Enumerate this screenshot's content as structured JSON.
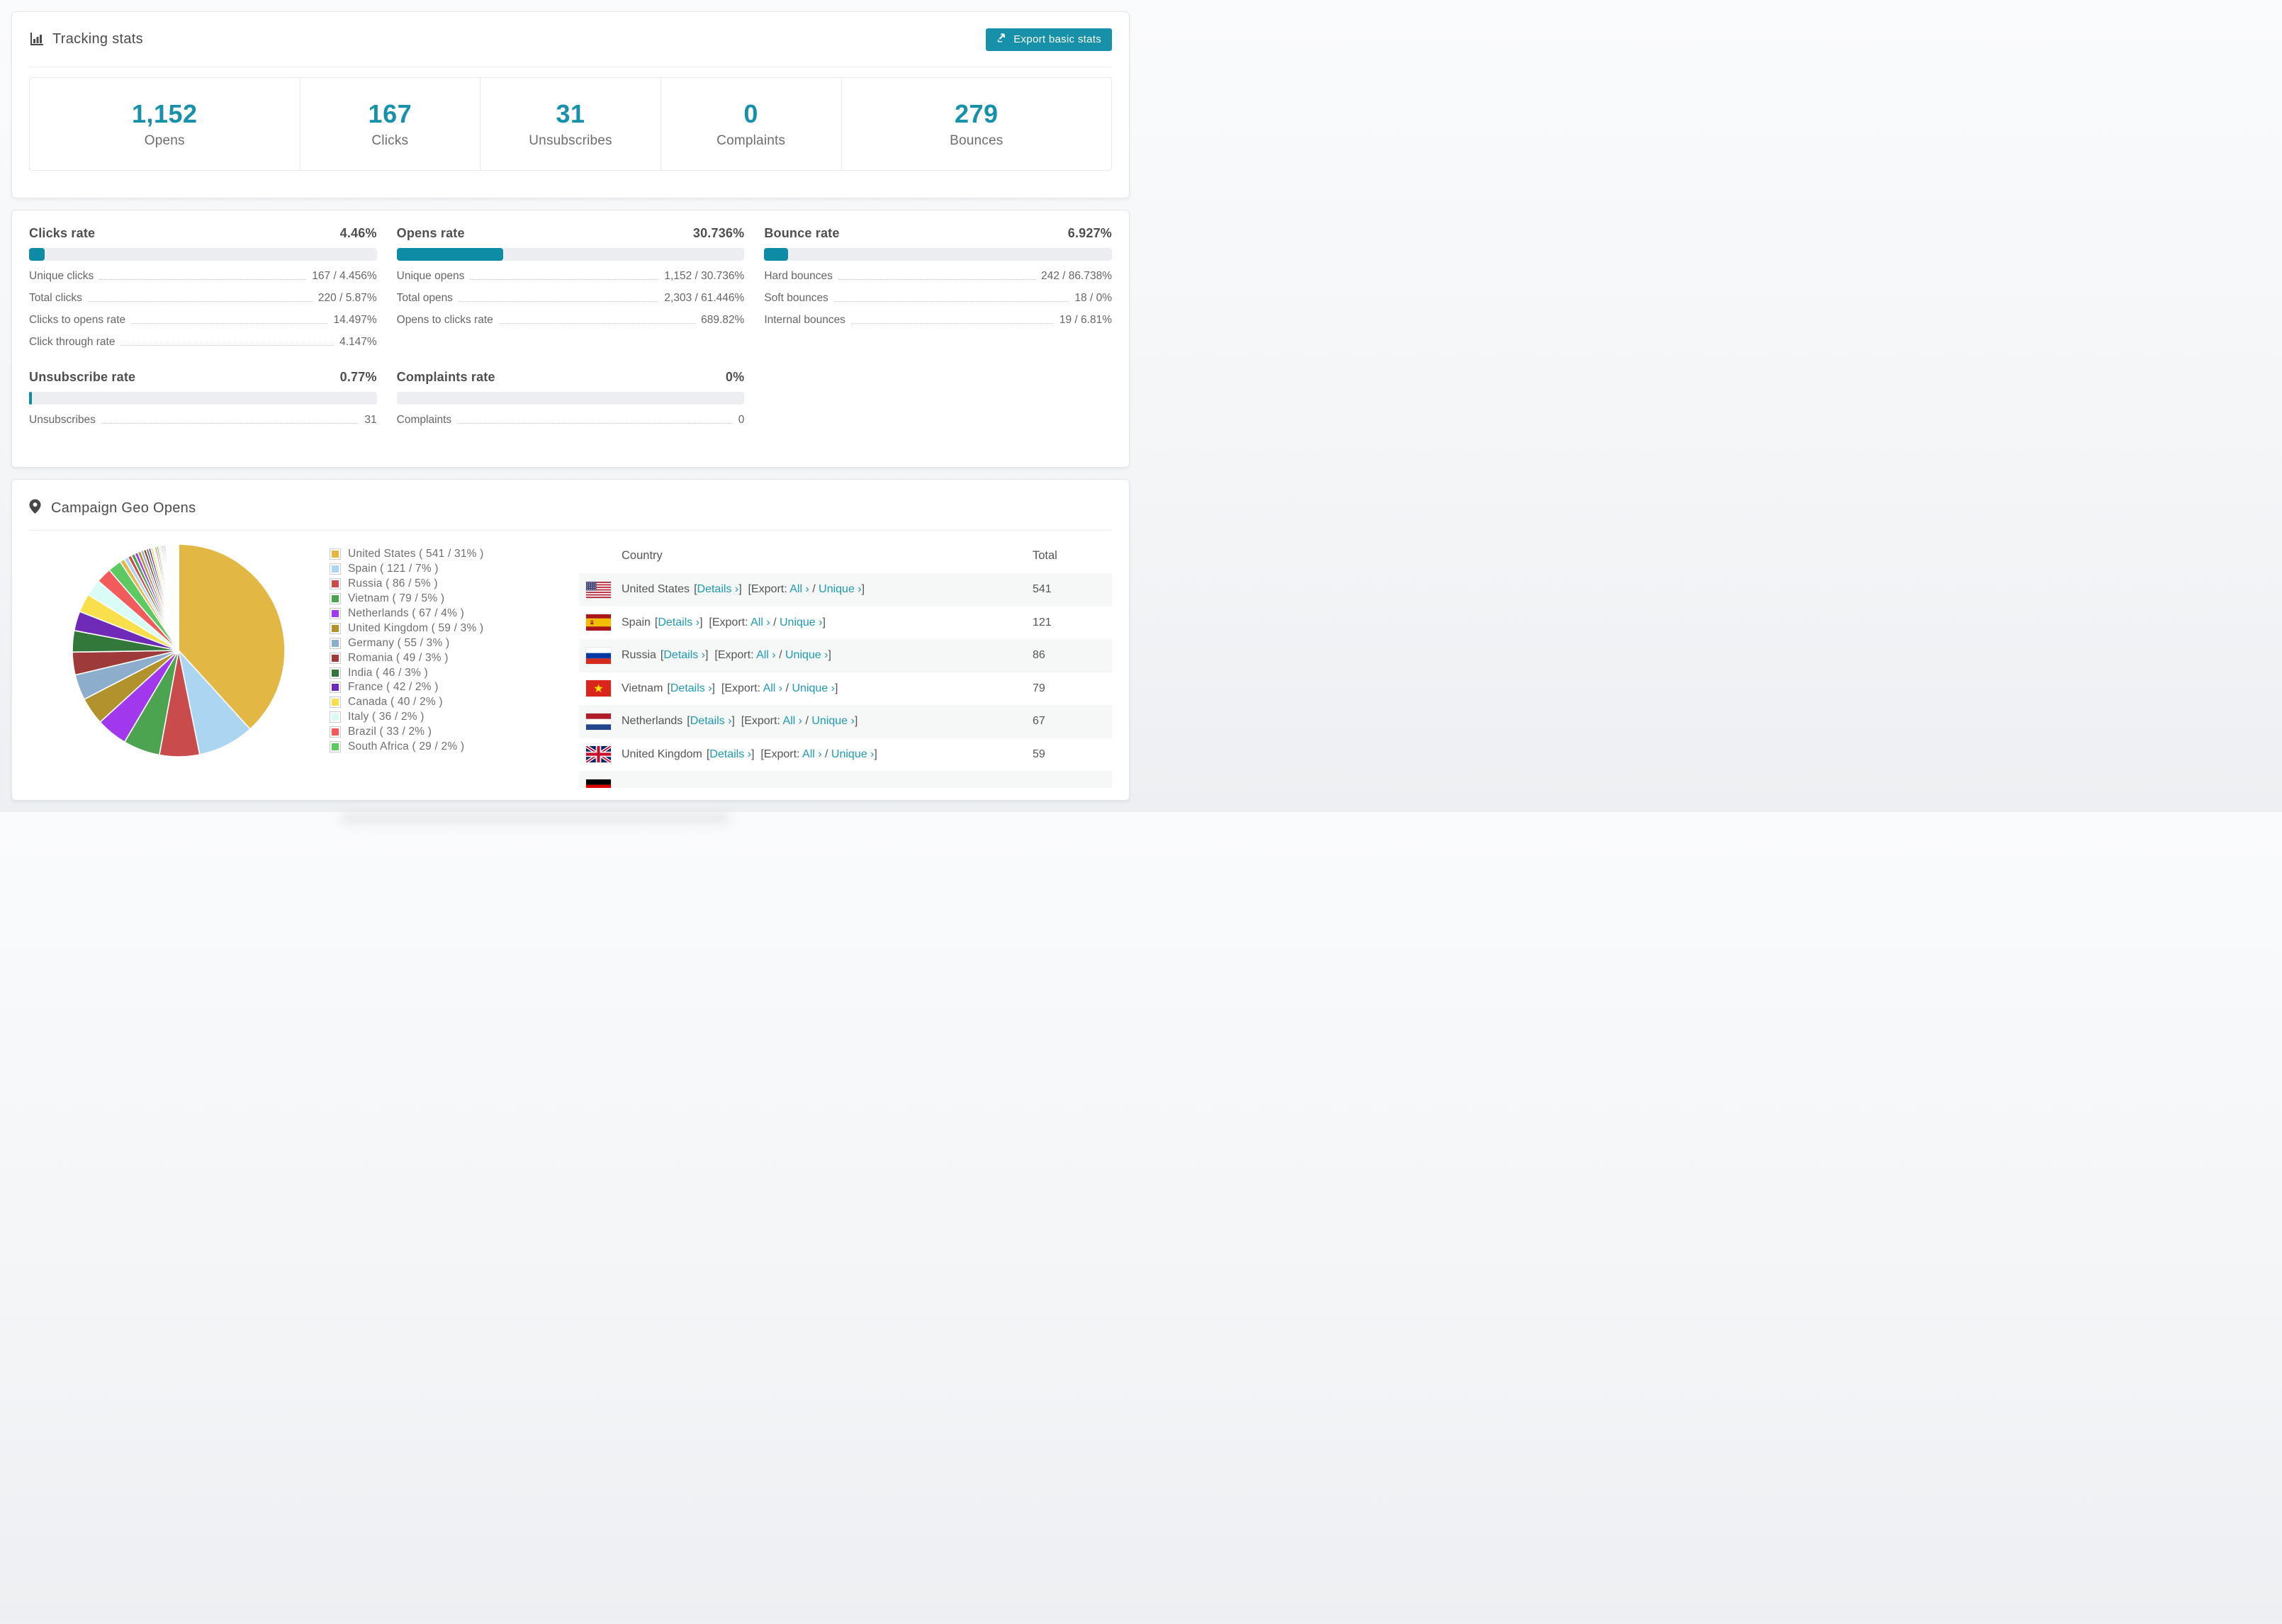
{
  "header": {
    "title": "Tracking stats",
    "export_button": "Export basic stats"
  },
  "summary_stats": [
    {
      "value": "1,152",
      "label": "Opens"
    },
    {
      "value": "167",
      "label": "Clicks"
    },
    {
      "value": "31",
      "label": "Unsubscribes"
    },
    {
      "value": "0",
      "label": "Complaints"
    },
    {
      "value": "279",
      "label": "Bounces"
    }
  ],
  "rate_blocks": [
    {
      "title": "Clicks rate",
      "value": "4.46%",
      "bar_percent": 4.46,
      "rows": [
        {
          "label": "Unique clicks",
          "value": "167 / 4.456%"
        },
        {
          "label": "Total clicks",
          "value": "220 / 5.87%"
        },
        {
          "label": "Clicks to opens rate",
          "value": "14.497%"
        },
        {
          "label": "Click through rate",
          "value": "4.147%"
        }
      ]
    },
    {
      "title": "Opens rate",
      "value": "30.736%",
      "bar_percent": 30.736,
      "rows": [
        {
          "label": "Unique opens",
          "value": "1,152 / 30.736%"
        },
        {
          "label": "Total opens",
          "value": "2,303 / 61.446%"
        },
        {
          "label": "Opens to clicks rate",
          "value": "689.82%"
        }
      ]
    },
    {
      "title": "Bounce rate",
      "value": "6.927%",
      "bar_percent": 6.927,
      "rows": [
        {
          "label": "Hard bounces",
          "value": "242 / 86.738%"
        },
        {
          "label": "Soft bounces",
          "value": "18 / 0%"
        },
        {
          "label": "Internal bounces",
          "value": "19 / 6.81%"
        }
      ]
    },
    {
      "title": "Unsubscribe rate",
      "value": "0.77%",
      "bar_percent": 0.77,
      "rows": [
        {
          "label": "Unsubscribes",
          "value": "31"
        }
      ]
    },
    {
      "title": "Complaints rate",
      "value": "0%",
      "bar_percent": 0,
      "rows": [
        {
          "label": "Complaints",
          "value": "0"
        }
      ]
    }
  ],
  "geo": {
    "title": "Campaign Geo Opens",
    "table": {
      "headers": {
        "country": "Country",
        "total": "Total"
      },
      "link_labels": {
        "details": "Details ›",
        "export_prefix": "Export:",
        "all": "All ›",
        "unique": "Unique ›"
      },
      "rows": [
        {
          "country": "United States",
          "flag": "us",
          "total": "541"
        },
        {
          "country": "Spain",
          "flag": "es",
          "total": "121"
        },
        {
          "country": "Russia",
          "flag": "ru",
          "total": "86"
        },
        {
          "country": "Vietnam",
          "flag": "vn",
          "total": "79"
        },
        {
          "country": "Netherlands",
          "flag": "nl",
          "total": "67"
        },
        {
          "country": "United Kingdom",
          "flag": "gb",
          "total": "59"
        }
      ],
      "partial_row": {
        "flag": "de"
      }
    }
  },
  "chart_data": {
    "type": "pie",
    "title": "Campaign Geo Opens",
    "legend_position": "right",
    "start": "top",
    "direction": "clockwise",
    "series": [
      {
        "name": "United States",
        "value": 541,
        "percent": 31,
        "color": "#E3B744"
      },
      {
        "name": "Spain",
        "value": 121,
        "percent": 7,
        "color": "#ACD5F2"
      },
      {
        "name": "Russia",
        "value": 86,
        "percent": 5,
        "color": "#C94B4B"
      },
      {
        "name": "Vietnam",
        "value": 79,
        "percent": 5,
        "color": "#4CA450"
      },
      {
        "name": "Netherlands",
        "value": 67,
        "percent": 4,
        "color": "#A238EE"
      },
      {
        "name": "United Kingdom",
        "value": 59,
        "percent": 3,
        "color": "#B2922C"
      },
      {
        "name": "Germany",
        "value": 55,
        "percent": 3,
        "color": "#8CADCB"
      },
      {
        "name": "Romania",
        "value": 49,
        "percent": 3,
        "color": "#9E3A3A"
      },
      {
        "name": "India",
        "value": 46,
        "percent": 3,
        "color": "#32783A"
      },
      {
        "name": "France",
        "value": 42,
        "percent": 2,
        "color": "#6F2BB8"
      },
      {
        "name": "Canada",
        "value": 40,
        "percent": 2,
        "color": "#F8DF4B"
      },
      {
        "name": "Italy",
        "value": 36,
        "percent": 2,
        "color": "#D9FDF6"
      },
      {
        "name": "Brazil",
        "value": 33,
        "percent": 2,
        "color": "#F15B5B"
      },
      {
        "name": "South Africa",
        "value": 29,
        "percent": 2,
        "color": "#5CC961"
      }
    ],
    "others_unlabeled_slices_estimate": [
      10,
      9,
      8,
      8,
      7,
      7,
      6,
      6,
      5,
      5,
      5,
      4,
      4,
      4,
      3,
      3,
      3,
      3,
      3,
      2,
      2,
      2,
      2,
      2,
      2,
      2,
      1,
      1,
      1,
      1,
      1,
      1,
      1,
      1,
      1,
      1,
      1,
      1,
      1,
      1
    ]
  },
  "colors": {
    "accent": "#1791A9",
    "link": "#1E9AB5",
    "bar_track": "#ECEEF1",
    "bar_fill": "#0E8CA5"
  }
}
